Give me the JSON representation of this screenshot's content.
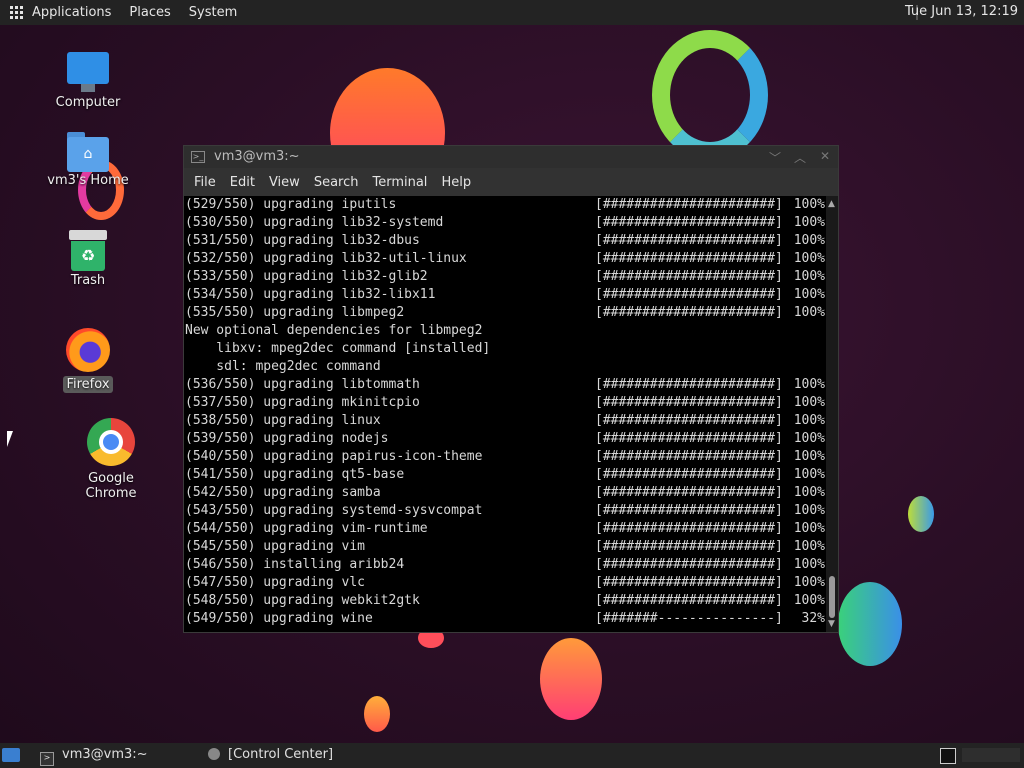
{
  "top_panel": {
    "menus": [
      "Applications",
      "Places",
      "System"
    ],
    "clock": "Tue Jun 13, 12:19"
  },
  "desktop_icons": [
    {
      "label": "Computer"
    },
    {
      "label": "vm3's Home"
    },
    {
      "label": "Trash"
    },
    {
      "label": "Firefox"
    },
    {
      "label": "Google Chrome"
    }
  ],
  "terminal": {
    "title": "vm3@vm3:~",
    "menu": [
      "File",
      "Edit",
      "View",
      "Search",
      "Terminal",
      "Help"
    ],
    "lines": [
      {
        "text": "(529/550) upgrading iputils",
        "progress": "[######################]",
        "pct": "100%"
      },
      {
        "text": "(530/550) upgrading lib32-systemd",
        "progress": "[######################]",
        "pct": "100%"
      },
      {
        "text": "(531/550) upgrading lib32-dbus",
        "progress": "[######################]",
        "pct": "100%"
      },
      {
        "text": "(532/550) upgrading lib32-util-linux",
        "progress": "[######################]",
        "pct": "100%"
      },
      {
        "text": "(533/550) upgrading lib32-glib2",
        "progress": "[######################]",
        "pct": "100%"
      },
      {
        "text": "(534/550) upgrading lib32-libx11",
        "progress": "[######################]",
        "pct": "100%"
      },
      {
        "text": "(535/550) upgrading libmpeg2",
        "progress": "[######################]",
        "pct": "100%"
      },
      {
        "text": "New optional dependencies for libmpeg2",
        "progress": "",
        "pct": ""
      },
      {
        "text": "    libxv: mpeg2dec command [installed]",
        "progress": "",
        "pct": ""
      },
      {
        "text": "    sdl: mpeg2dec command",
        "progress": "",
        "pct": ""
      },
      {
        "text": "(536/550) upgrading libtommath",
        "progress": "[######################]",
        "pct": "100%"
      },
      {
        "text": "(537/550) upgrading mkinitcpio",
        "progress": "[######################]",
        "pct": "100%"
      },
      {
        "text": "(538/550) upgrading linux",
        "progress": "[######################]",
        "pct": "100%"
      },
      {
        "text": "(539/550) upgrading nodejs",
        "progress": "[######################]",
        "pct": "100%"
      },
      {
        "text": "(540/550) upgrading papirus-icon-theme",
        "progress": "[######################]",
        "pct": "100%"
      },
      {
        "text": "(541/550) upgrading qt5-base",
        "progress": "[######################]",
        "pct": "100%"
      },
      {
        "text": "(542/550) upgrading samba",
        "progress": "[######################]",
        "pct": "100%"
      },
      {
        "text": "(543/550) upgrading systemd-sysvcompat",
        "progress": "[######################]",
        "pct": "100%"
      },
      {
        "text": "(544/550) upgrading vim-runtime",
        "progress": "[######################]",
        "pct": "100%"
      },
      {
        "text": "(545/550) upgrading vim",
        "progress": "[######################]",
        "pct": "100%"
      },
      {
        "text": "(546/550) installing aribb24",
        "progress": "[######################]",
        "pct": "100%"
      },
      {
        "text": "(547/550) upgrading vlc",
        "progress": "[######################]",
        "pct": "100%"
      },
      {
        "text": "(548/550) upgrading webkit2gtk",
        "progress": "[######################]",
        "pct": "100%"
      },
      {
        "text": "(549/550) upgrading wine",
        "progress": "[#######---------------]",
        "pct": "32%"
      }
    ]
  },
  "taskbar": {
    "tasks": [
      "vm3@vm3:~",
      "[Control Center]"
    ]
  }
}
